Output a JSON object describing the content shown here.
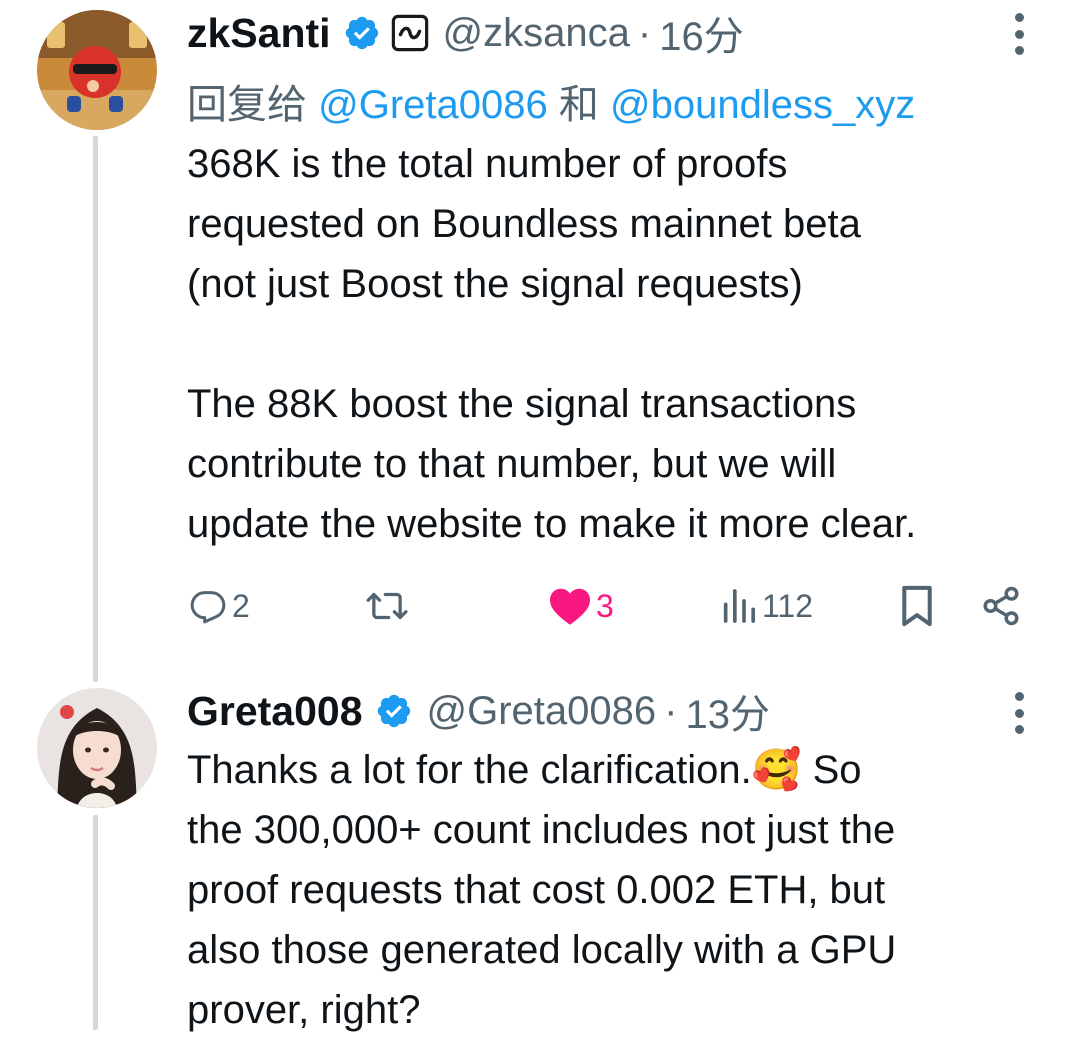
{
  "tweets": [
    {
      "display_name": "zkSanti",
      "handle": "@zksanca",
      "separator": "·",
      "time": "16分",
      "reply_to": {
        "prefix": "回复给",
        "user1": "@Greta0086",
        "conj": "和",
        "user2": "@boundless_xyz"
      },
      "paragraphs": [
        [
          "368K is the total number of proofs",
          "requested on Boundless mainnet beta",
          "(not just Boost the signal requests)"
        ],
        [
          "The 88K boost the signal transactions",
          "contribute to that number, but we will",
          "update the website to make it more clear."
        ]
      ],
      "actions": {
        "replies": "2",
        "retweets": "",
        "likes": "3",
        "views": "112"
      },
      "icons": [
        "verified-badge-icon",
        "affiliate-badge-icon",
        "more-icon",
        "reply-icon",
        "retweet-icon",
        "heart-icon",
        "views-icon",
        "bookmark-icon",
        "share-icon"
      ]
    },
    {
      "display_name": "Greta008",
      "handle": "@Greta0086",
      "separator": "·",
      "time": "13分",
      "lines": [
        "Thanks a lot for the clarification.🥰 So",
        "the 300,000+ count includes not just the",
        "proof requests that cost 0.002 ETH, but",
        "also those generated locally with a GPU",
        "prover, right?"
      ],
      "icons": [
        "verified-badge-icon",
        "more-icon"
      ]
    }
  ],
  "colors": {
    "accent": "#1d9bf0",
    "like": "#f91880",
    "secondary_text": "#536471",
    "thread_line": "#cfd9de"
  }
}
